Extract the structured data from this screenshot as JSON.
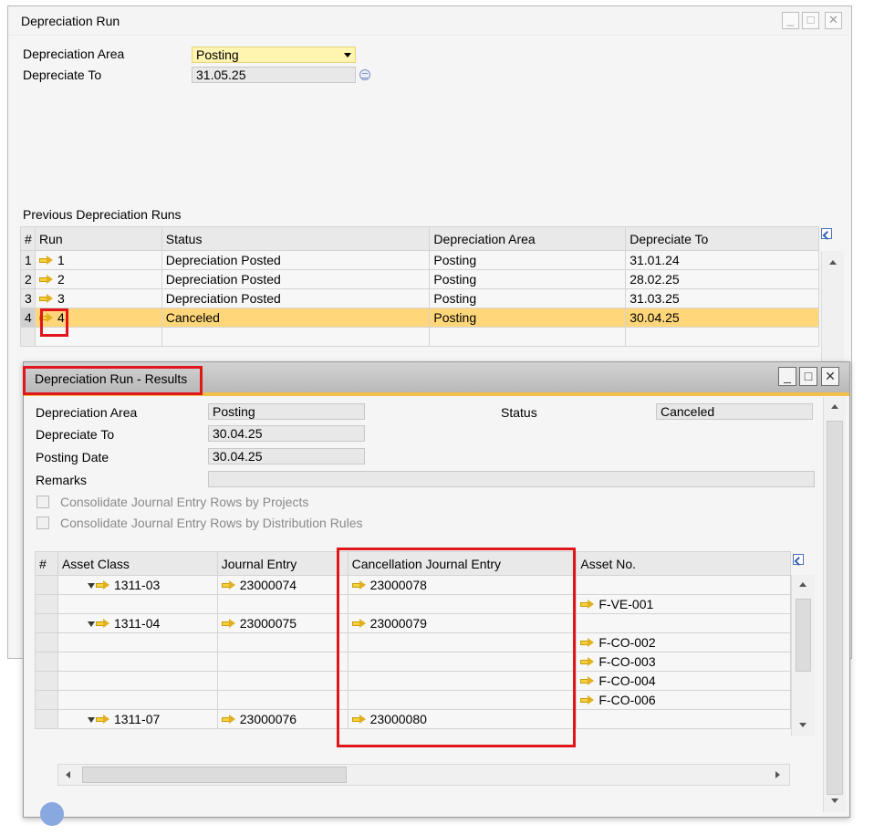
{
  "back_window": {
    "title": "Depreciation Run",
    "buttons": {
      "minimize": "_",
      "maximize": "□",
      "close": "✕"
    },
    "depreciation_area_label": "Depreciation Area",
    "depreciation_area_value": "Posting",
    "depreciate_to_label": "Depreciate To",
    "depreciate_to_value": "31.05.25",
    "previous_runs_label": "Previous Depreciation Runs",
    "columns": [
      "#",
      "Run",
      "Status",
      "Depreciation Area",
      "Depreciate To"
    ],
    "rows": [
      {
        "idx": "1",
        "run": "1",
        "status": "Depreciation Posted",
        "area": "Posting",
        "date": "31.01.24"
      },
      {
        "idx": "2",
        "run": "2",
        "status": "Depreciation Posted",
        "area": "Posting",
        "date": "28.02.25"
      },
      {
        "idx": "3",
        "run": "3",
        "status": "Depreciation Posted",
        "area": "Posting",
        "date": "31.03.25"
      },
      {
        "idx": "4",
        "run": "4",
        "status": "Canceled",
        "area": "Posting",
        "date": "30.04.25"
      }
    ]
  },
  "results_window": {
    "title": "Depreciation Run - Results",
    "buttons": {
      "minimize": "_",
      "maximize": "□",
      "close": "✕"
    },
    "depreciation_area_label": "Depreciation Area",
    "depreciation_area_value": "Posting",
    "status_label": "Status",
    "status_value": "Canceled",
    "depreciate_to_label": "Depreciate To",
    "depreciate_to_value": "30.04.25",
    "posting_date_label": "Posting Date",
    "posting_date_value": "30.04.25",
    "remarks_label": "Remarks",
    "remarks_value": "",
    "consolidate_projects_label": "Consolidate Journal Entry Rows by Projects",
    "consolidate_distribution_label": "Consolidate Journal Entry Rows by Distribution Rules",
    "columns": [
      "#",
      "Asset Class",
      "Journal Entry",
      "Cancellation Journal Entry",
      "Asset No."
    ],
    "rows": [
      {
        "asset_class": "1311-03",
        "journal_entry": "23000074",
        "cancellation": "23000078",
        "asset_no": ""
      },
      {
        "asset_class": "",
        "journal_entry": "",
        "cancellation": "",
        "asset_no": "F-VE-001"
      },
      {
        "asset_class": "1311-04",
        "journal_entry": "23000075",
        "cancellation": "23000079",
        "asset_no": ""
      },
      {
        "asset_class": "",
        "journal_entry": "",
        "cancellation": "",
        "asset_no": "F-CO-002"
      },
      {
        "asset_class": "",
        "journal_entry": "",
        "cancellation": "",
        "asset_no": "F-CO-003"
      },
      {
        "asset_class": "",
        "journal_entry": "",
        "cancellation": "",
        "asset_no": "F-CO-004"
      },
      {
        "asset_class": "",
        "journal_entry": "",
        "cancellation": "",
        "asset_no": "F-CO-006"
      },
      {
        "asset_class": "1311-07",
        "journal_entry": "23000076",
        "cancellation": "23000080",
        "asset_no": ""
      }
    ]
  },
  "colors": {
    "highlight_row": "#ffd77a",
    "accent": "#f0c048",
    "annotation_red": "#e0161b"
  }
}
